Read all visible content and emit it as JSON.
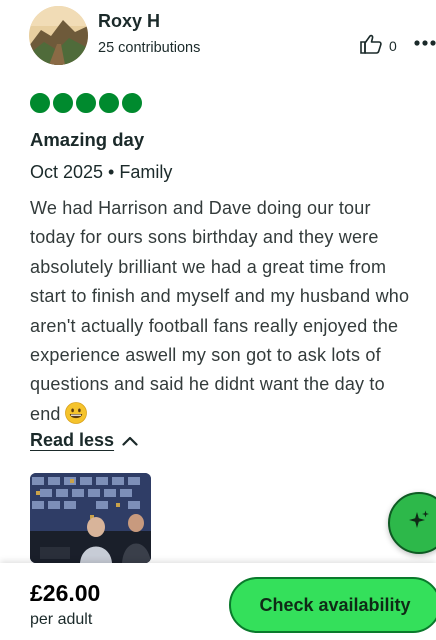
{
  "review": {
    "user_name": "Roxy H",
    "contributions": "25 contributions",
    "helpful_count": "0",
    "rating_value": 5,
    "rating_max": 5,
    "title": "Amazing day",
    "meta": "Oct 2025 • Family",
    "body": "We had Harrison and Dave doing our tour\ntoday for ours sons birthday and they were\nabsolutely brilliant we had a great time from\nstart to finish and myself and my husband who\naren't actually football fans really enjoyed the\nexperience aswell my son got to ask lots of\nquestions and said he didnt want the day to\nend",
    "read_less_label": "Read less"
  },
  "footer": {
    "price": "£26.00",
    "per": "per adult",
    "cta_label": "Check availability"
  },
  "colors": {
    "rating_green": "#008a2e",
    "cta_green": "#34e05b",
    "fab_green": "#2db84a"
  },
  "icons": {
    "helpful": "thumbs-up-icon",
    "more": "more-dots-icon",
    "read_less": "chevron-up-icon",
    "fab": "sparkle-icon",
    "emoji": "grinning-face-emoji"
  }
}
